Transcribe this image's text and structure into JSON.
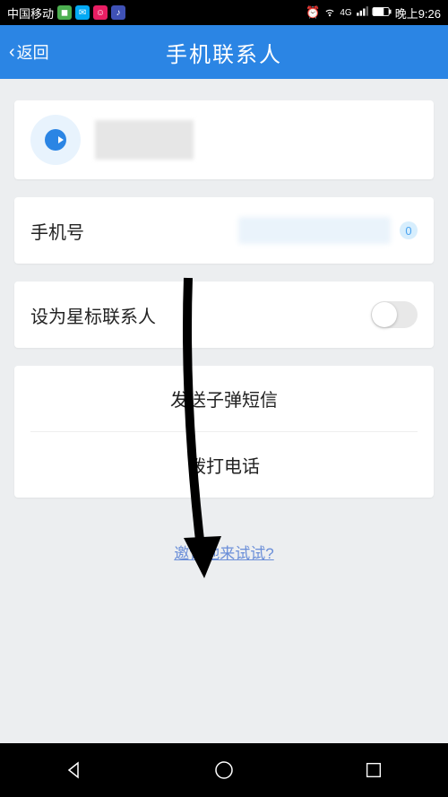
{
  "status": {
    "carrier": "中国移动",
    "network": "4G",
    "time": "晚上9:26"
  },
  "titlebar": {
    "back": "返回",
    "title": "手机联系人"
  },
  "phone": {
    "label": "手机号",
    "badge": "0"
  },
  "star": {
    "label": "设为星标联系人"
  },
  "actions": {
    "send_sms": "发送子弹短信",
    "call": "拨打电话"
  },
  "invite": "邀请他来试试?"
}
